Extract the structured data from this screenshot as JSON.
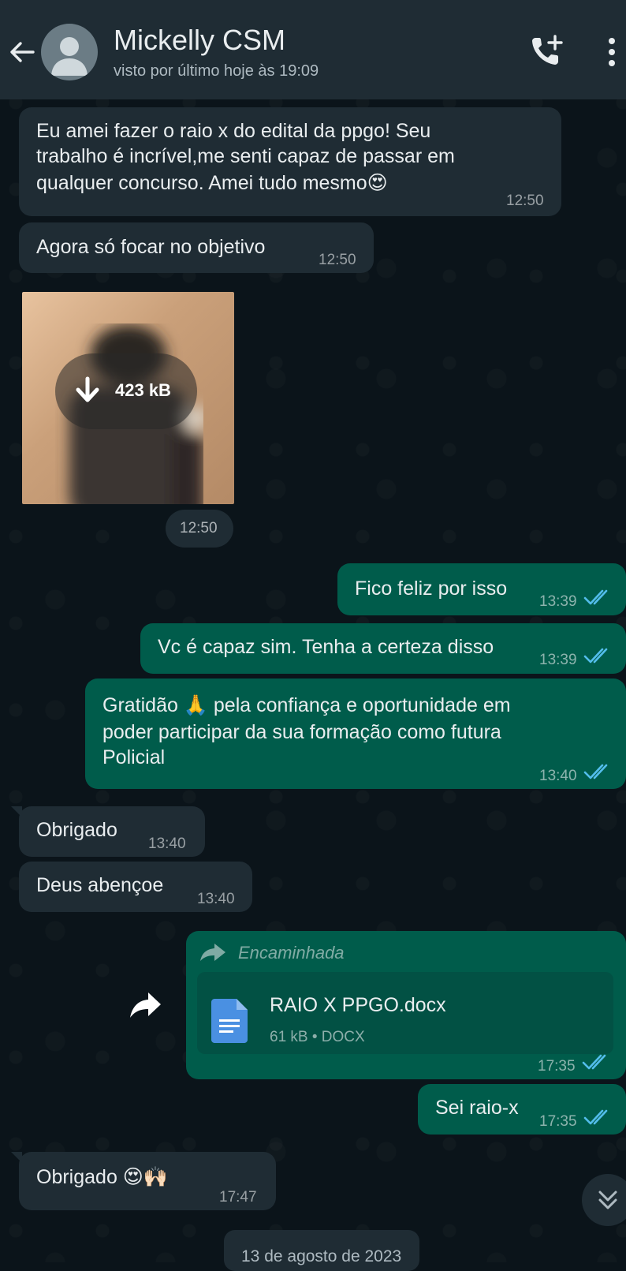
{
  "header": {
    "contact_name": "Mickelly CSM",
    "status": "visto por último hoje às 19:09"
  },
  "messages": [
    {
      "dir": "in",
      "lines": [
        "Eu amei fazer o raio x do edital da ppgo! Seu",
        "trabalho é  incrível,me senti capaz de passar em",
        "qualquer concurso. Amei tudo mesmo😍"
      ],
      "time": "12:50"
    },
    {
      "dir": "in",
      "text": "Agora só  focar no objetivo",
      "time": "12:50"
    },
    {
      "dir": "in",
      "type": "image",
      "download_size": "423 kB",
      "time": "12:50"
    },
    {
      "dir": "out",
      "text": "Fico feliz por isso",
      "time": "13:39",
      "status": "read"
    },
    {
      "dir": "out",
      "text": "Vc é capaz sim. Tenha a certeza disso",
      "time": "13:39",
      "status": "read"
    },
    {
      "dir": "out",
      "lines": [
        "Gratidão 🙏 pela confiança e oportunidade em",
        "poder participar da sua formação como futura",
        "Policial"
      ],
      "time": "13:40",
      "status": "read"
    },
    {
      "dir": "in",
      "text": "Obrigado",
      "time": "13:40"
    },
    {
      "dir": "in",
      "text": "Deus abençoe",
      "time": "13:40"
    },
    {
      "dir": "out",
      "type": "document",
      "forwarded_label": "Encaminhada",
      "file_name": "RAIO X PPGO.docx",
      "file_meta": "61 kB • DOCX",
      "time": "17:35",
      "status": "read"
    },
    {
      "dir": "out",
      "text": "Sei raio-x",
      "time": "17:35",
      "status": "read"
    },
    {
      "dir": "in",
      "text": "Obrigado 😍🙌🏻",
      "time": "17:47"
    }
  ],
  "date_divider": "13 de agosto de 2023",
  "colors": {
    "header_bg": "#1f2c34",
    "chat_bg": "#0b141a",
    "incoming_bubble": "#1f2c34",
    "outgoing_bubble": "#005c4b",
    "read_ticks": "#53bdeb"
  },
  "icons": [
    "back-arrow-icon",
    "avatar-placeholder-icon",
    "add-call-icon",
    "menu-dots-icon",
    "download-icon",
    "forward-icon",
    "document-icon",
    "double-check-icon",
    "scroll-down-icon"
  ]
}
